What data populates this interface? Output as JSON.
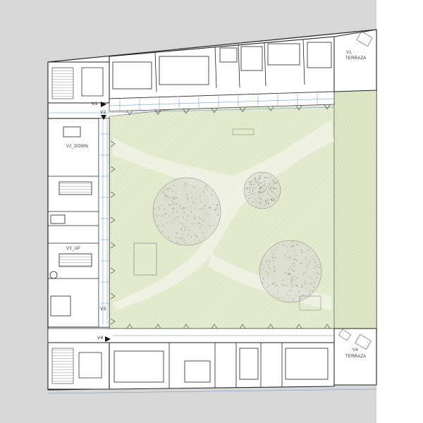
{
  "labels": {
    "v1": "V1",
    "v2": "V2",
    "v3": "V3",
    "v4": "V4",
    "v1_terrace_code": "V1",
    "v1_terrace": "TERRAZA",
    "v4_terrace_code": "V4",
    "v4_terrace": "TERRAZA",
    "v2_down": "V2_DOWN",
    "v3_up": "V3_UP"
  },
  "colors": {
    "background": "#d7d7d7",
    "paper": "#ffffff",
    "courtyard": "#e6ecd2",
    "strip": "#dfe8c8",
    "path": "#f3f3ea",
    "wall": "#333333",
    "dimension": "#5b8fd6"
  }
}
